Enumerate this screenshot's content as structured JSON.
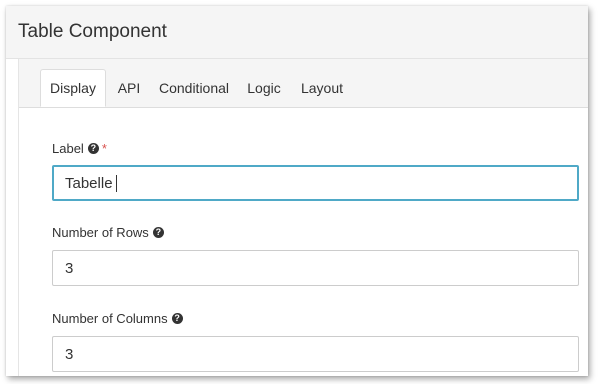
{
  "dialog": {
    "title": "Table Component"
  },
  "tabs": [
    {
      "label": "Display",
      "active": true
    },
    {
      "label": "API",
      "active": false
    },
    {
      "label": "Conditional",
      "active": false
    },
    {
      "label": "Logic",
      "active": false
    },
    {
      "label": "Layout",
      "active": false
    }
  ],
  "fields": {
    "label": {
      "label": "Label",
      "required_mark": "*",
      "value": "Tabelle"
    },
    "rows": {
      "label": "Number of Rows",
      "value": "3"
    },
    "columns": {
      "label": "Number of Columns",
      "value": "3"
    }
  },
  "icons": {
    "help": "question-circle-icon"
  },
  "colors": {
    "focus_border": "#4fa9c7",
    "required": "#d9534f"
  }
}
